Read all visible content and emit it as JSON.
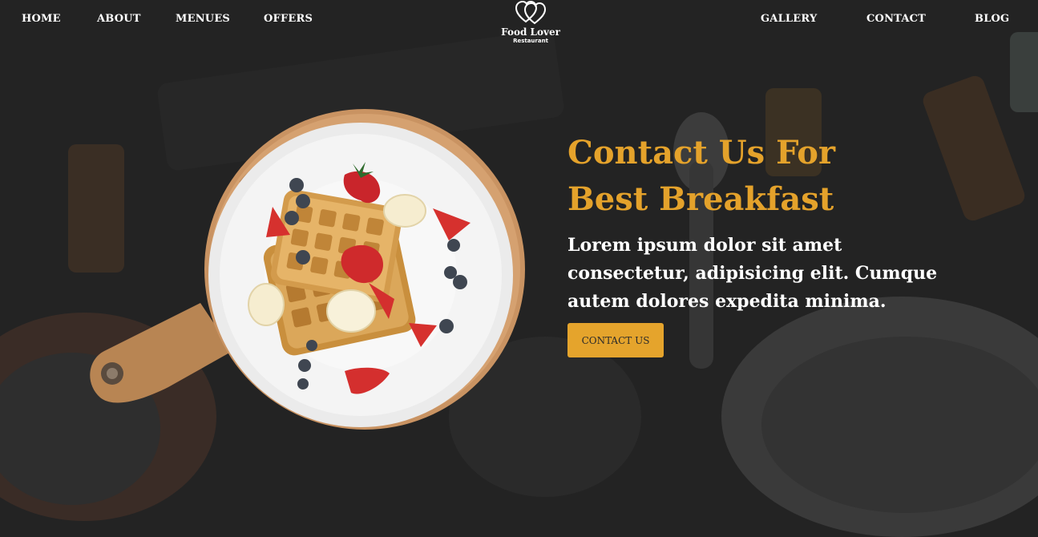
{
  "nav": {
    "left": [
      "HOME",
      "ABOUT",
      "MENUES",
      "OFFERS"
    ],
    "right": [
      "GALLERY",
      "CONTACT",
      "BLOG"
    ]
  },
  "logo": {
    "name": "Food Lover",
    "subtitle": "Restaurant",
    "icon": "double-heart-icon"
  },
  "hero": {
    "title_line1": "Contact Us For",
    "title_line2": "Best Breakfast",
    "text": "Lorem ipsum dolor sit amet consectetur, adipisicing elit. Cumque autem dolores expedita minima.",
    "cta_label": "CONTACT US",
    "image": "waffles-on-plate-image"
  },
  "colors": {
    "accent": "#e5a42c",
    "background": "#232323",
    "nav_text": "#ffffff"
  }
}
